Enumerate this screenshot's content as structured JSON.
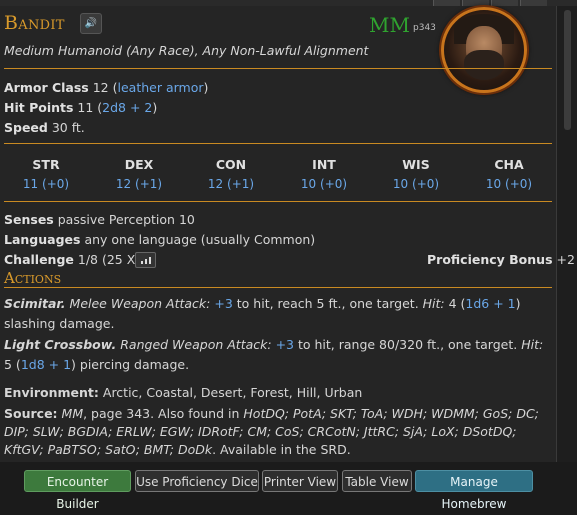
{
  "monster": {
    "name": "Bandit",
    "source_abbr": "MM",
    "source_page": "p343",
    "subtitle": "Medium Humanoid (Any Race), Any Non-Lawful Alignment",
    "armor_class": {
      "label": "Armor Class",
      "value": "12",
      "detail": "leather armor"
    },
    "hit_points": {
      "label": "Hit Points",
      "value": "11",
      "formula": "2d8 + 2"
    },
    "speed": {
      "label": "Speed",
      "value": "30 ft."
    },
    "abilities": [
      {
        "name": "STR",
        "value": "11 (+0)"
      },
      {
        "name": "DEX",
        "value": "12 (+1)"
      },
      {
        "name": "CON",
        "value": "12 (+1)"
      },
      {
        "name": "INT",
        "value": "10 (+0)"
      },
      {
        "name": "WIS",
        "value": "10 (+0)"
      },
      {
        "name": "CHA",
        "value": "10 (+0)"
      }
    ],
    "senses": {
      "label": "Senses",
      "value": "passive Perception 10"
    },
    "languages": {
      "label": "Languages",
      "value": "any one language (usually Common)"
    },
    "challenge": {
      "label": "Challenge",
      "value": "1/8 (25 XP)"
    },
    "proficiency": {
      "label": "Proficiency Bonus",
      "value": "+2"
    },
    "actions_heading": "Actions",
    "actions": [
      {
        "name": "Scimitar.",
        "type": "Melee Weapon Attack:",
        "bonus": "+3",
        "text1": " to hit, reach 5 ft., one target. ",
        "hit_label": "Hit:",
        "hit_pre": " 4 (",
        "dice": "1d6 + 1",
        "hit_post": ") slashing damage."
      },
      {
        "name": "Light Crossbow.",
        "type": "Ranged Weapon Attack:",
        "bonus": "+3",
        "text1": " to hit, range 80/320 ft., one target. ",
        "hit_label": "Hit:",
        "hit_pre": " 5 (",
        "dice": "1d8 + 1",
        "hit_post": ") piercing damage."
      }
    ],
    "environment": {
      "label": "Environment:",
      "value": "Arctic, Coastal, Desert, Forest, Hill, Urban"
    },
    "source": {
      "label": "Source:",
      "book": "MM",
      "page_text": ", page 343. Also found in ",
      "also_found": "HotDQ; PotA; SKT; ToA; WDH; WDMM; GoS; DC; DIP; SLW; BGDIA; ERLW; EGW; IDRotF; CM; CoS; CRCotN; JttRC; SjA; LoX; DSotDQ; KftGV; PaBTSO; SatO; BMT; DoDk",
      "tail": ". Available in the SRD."
    }
  },
  "buttons": {
    "encounter": "Encounter Builder",
    "prof_dice": "Use Proficiency Dice",
    "printer": "Printer View",
    "table": "Table View",
    "homebrew": "Manage Homebrew"
  },
  "icons": {
    "sound": "speaker-icon",
    "challenge": "bar-chart-icon"
  },
  "colors": {
    "accent": "#d99a2b",
    "link": "#6aa7e8",
    "mm": "#2fa32f"
  }
}
